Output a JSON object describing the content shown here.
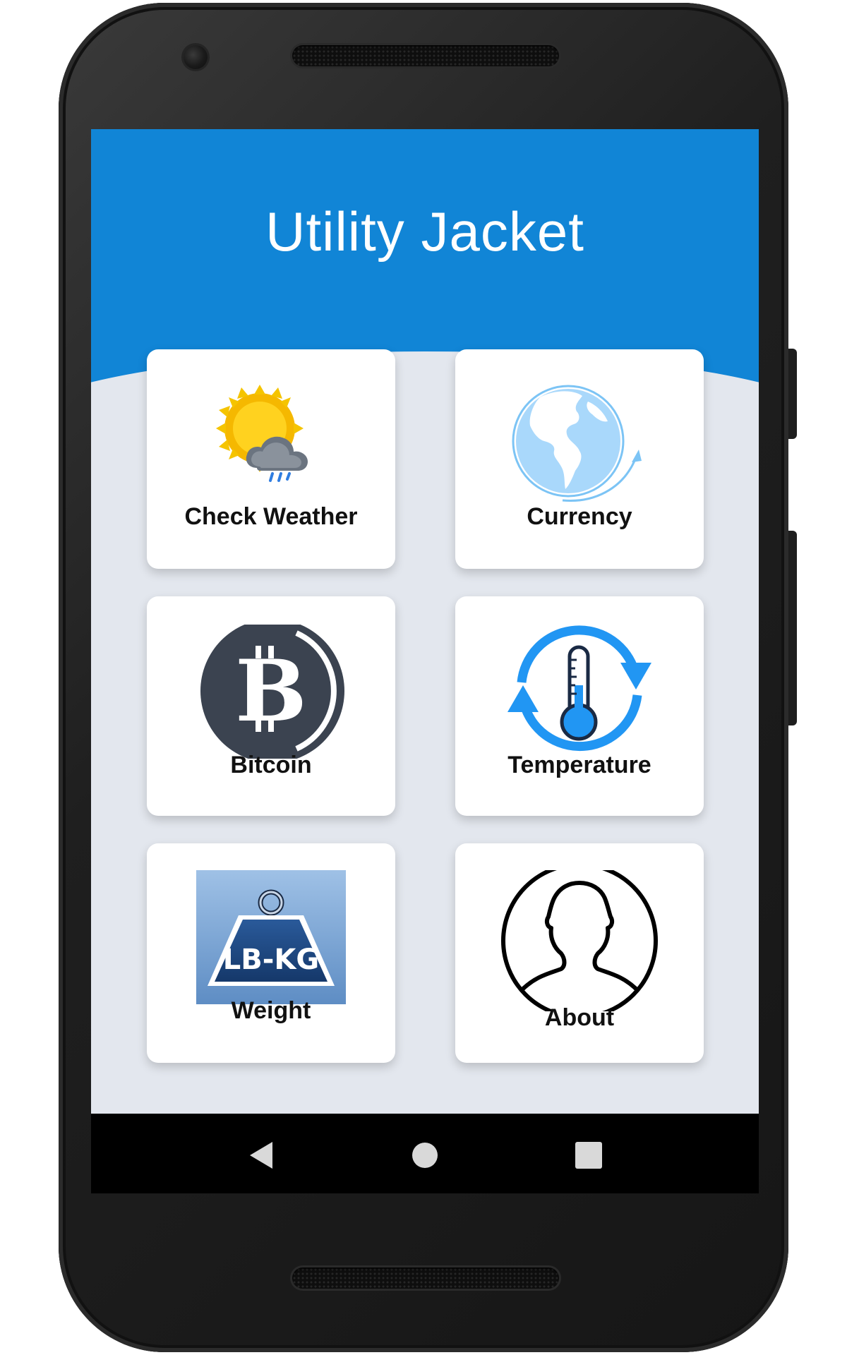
{
  "app": {
    "title": "Utility Jacket"
  },
  "colors": {
    "header": "#1185d6",
    "background": "#e3e7ee",
    "card": "#ffffff",
    "accent_blue": "#2196f3"
  },
  "menu": {
    "items": [
      {
        "label": "Check Weather",
        "icon": "weather-icon"
      },
      {
        "label": "Currency",
        "icon": "globe-icon"
      },
      {
        "label": "Bitcoin",
        "icon": "bitcoin-icon"
      },
      {
        "label": "Temperature",
        "icon": "thermometer-icon"
      },
      {
        "label": "Weight",
        "icon": "weight-icon",
        "icon_text": "LB-KG"
      },
      {
        "label": "About",
        "icon": "person-icon"
      }
    ]
  },
  "navbar": {
    "buttons": [
      "back-icon",
      "home-icon",
      "recents-icon"
    ]
  }
}
